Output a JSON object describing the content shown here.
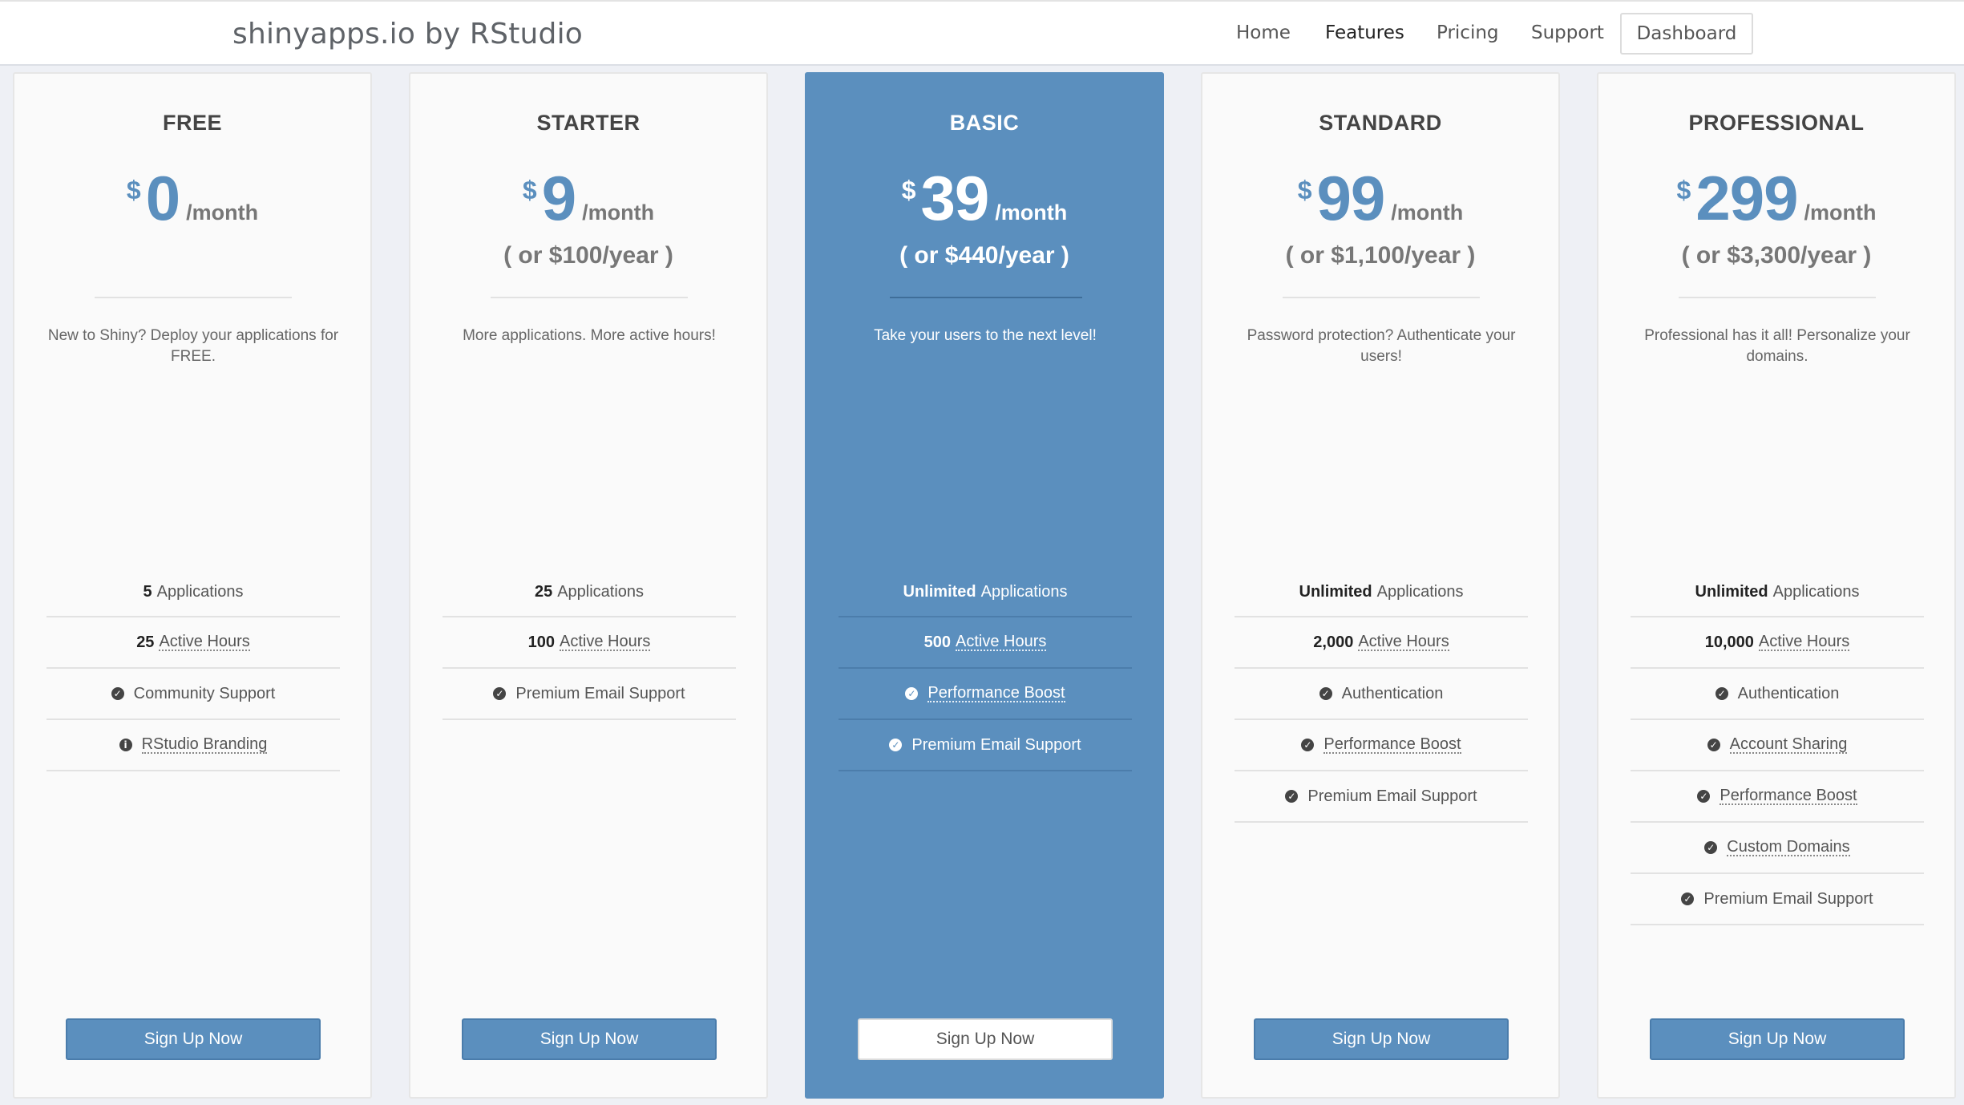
{
  "header": {
    "brand": "shinyapps.io by RStudio",
    "nav": [
      {
        "label": "Home"
      },
      {
        "label": "Features"
      },
      {
        "label": "Pricing"
      },
      {
        "label": "Support"
      }
    ],
    "dashboard_label": "Dashboard"
  },
  "colors": {
    "accent": "#5b8fbe",
    "page_background": "#eef0f5",
    "card_background": "#fafafa"
  },
  "plans": [
    {
      "name": "FREE",
      "currency": "$",
      "amount": "0",
      "period": "/month",
      "yearly": "",
      "description": "New to Shiny? Deploy your applications for FREE.",
      "features": [
        {
          "strong": "5",
          "text": "Applications",
          "icon": "",
          "underline": false
        },
        {
          "strong": "25",
          "text": "Active Hours",
          "icon": "",
          "underline": true
        },
        {
          "strong": "",
          "text": "Community Support",
          "icon": "check-circle-icon",
          "underline": false
        },
        {
          "strong": "",
          "text": "RStudio Branding",
          "icon": "info-circle-icon",
          "underline": true
        }
      ],
      "cta": "Sign Up Now"
    },
    {
      "name": "STARTER",
      "currency": "$",
      "amount": "9",
      "period": "/month",
      "yearly": "( or $100/year )",
      "description": "More applications. More active hours!",
      "features": [
        {
          "strong": "25",
          "text": "Applications",
          "icon": "",
          "underline": false
        },
        {
          "strong": "100",
          "text": "Active Hours",
          "icon": "",
          "underline": true
        },
        {
          "strong": "",
          "text": "Premium Email Support",
          "icon": "check-circle-icon",
          "underline": false
        }
      ],
      "cta": "Sign Up Now"
    },
    {
      "name": "BASIC",
      "currency": "$",
      "amount": "39",
      "period": "/month",
      "yearly": "( or $440/year )",
      "description": "Take your users to the next level!",
      "features": [
        {
          "strong": "Unlimited",
          "text": "Applications",
          "icon": "",
          "underline": false
        },
        {
          "strong": "500",
          "text": "Active Hours",
          "icon": "",
          "underline": true
        },
        {
          "strong": "",
          "text": "Performance Boost",
          "icon": "check-circle-icon",
          "underline": true
        },
        {
          "strong": "",
          "text": "Premium Email Support",
          "icon": "check-circle-icon",
          "underline": false
        }
      ],
      "cta": "Sign Up Now"
    },
    {
      "name": "STANDARD",
      "currency": "$",
      "amount": "99",
      "period": "/month",
      "yearly": "( or $1,100/year )",
      "description": "Password protection? Authenticate your users!",
      "features": [
        {
          "strong": "Unlimited",
          "text": "Applications",
          "icon": "",
          "underline": false
        },
        {
          "strong": "2,000",
          "text": "Active Hours",
          "icon": "",
          "underline": true
        },
        {
          "strong": "",
          "text": "Authentication",
          "icon": "check-circle-icon",
          "underline": false
        },
        {
          "strong": "",
          "text": "Performance Boost",
          "icon": "check-circle-icon",
          "underline": true
        },
        {
          "strong": "",
          "text": "Premium Email Support",
          "icon": "check-circle-icon",
          "underline": false
        }
      ],
      "cta": "Sign Up Now"
    },
    {
      "name": "PROFESSIONAL",
      "currency": "$",
      "amount": "299",
      "period": "/month",
      "yearly": "( or $3,300/year )",
      "description": "Professional has it all! Personalize your domains.",
      "features": [
        {
          "strong": "Unlimited",
          "text": "Applications",
          "icon": "",
          "underline": false
        },
        {
          "strong": "10,000",
          "text": "Active Hours",
          "icon": "",
          "underline": true
        },
        {
          "strong": "",
          "text": "Authentication",
          "icon": "check-circle-icon",
          "underline": false
        },
        {
          "strong": "",
          "text": "Account Sharing",
          "icon": "check-circle-icon",
          "underline": true
        },
        {
          "strong": "",
          "text": "Performance Boost",
          "icon": "check-circle-icon",
          "underline": true
        },
        {
          "strong": "",
          "text": "Custom Domains",
          "icon": "check-circle-icon",
          "underline": true
        },
        {
          "strong": "",
          "text": "Premium Email Support",
          "icon": "check-circle-icon",
          "underline": false
        }
      ],
      "cta": "Sign Up Now"
    }
  ]
}
